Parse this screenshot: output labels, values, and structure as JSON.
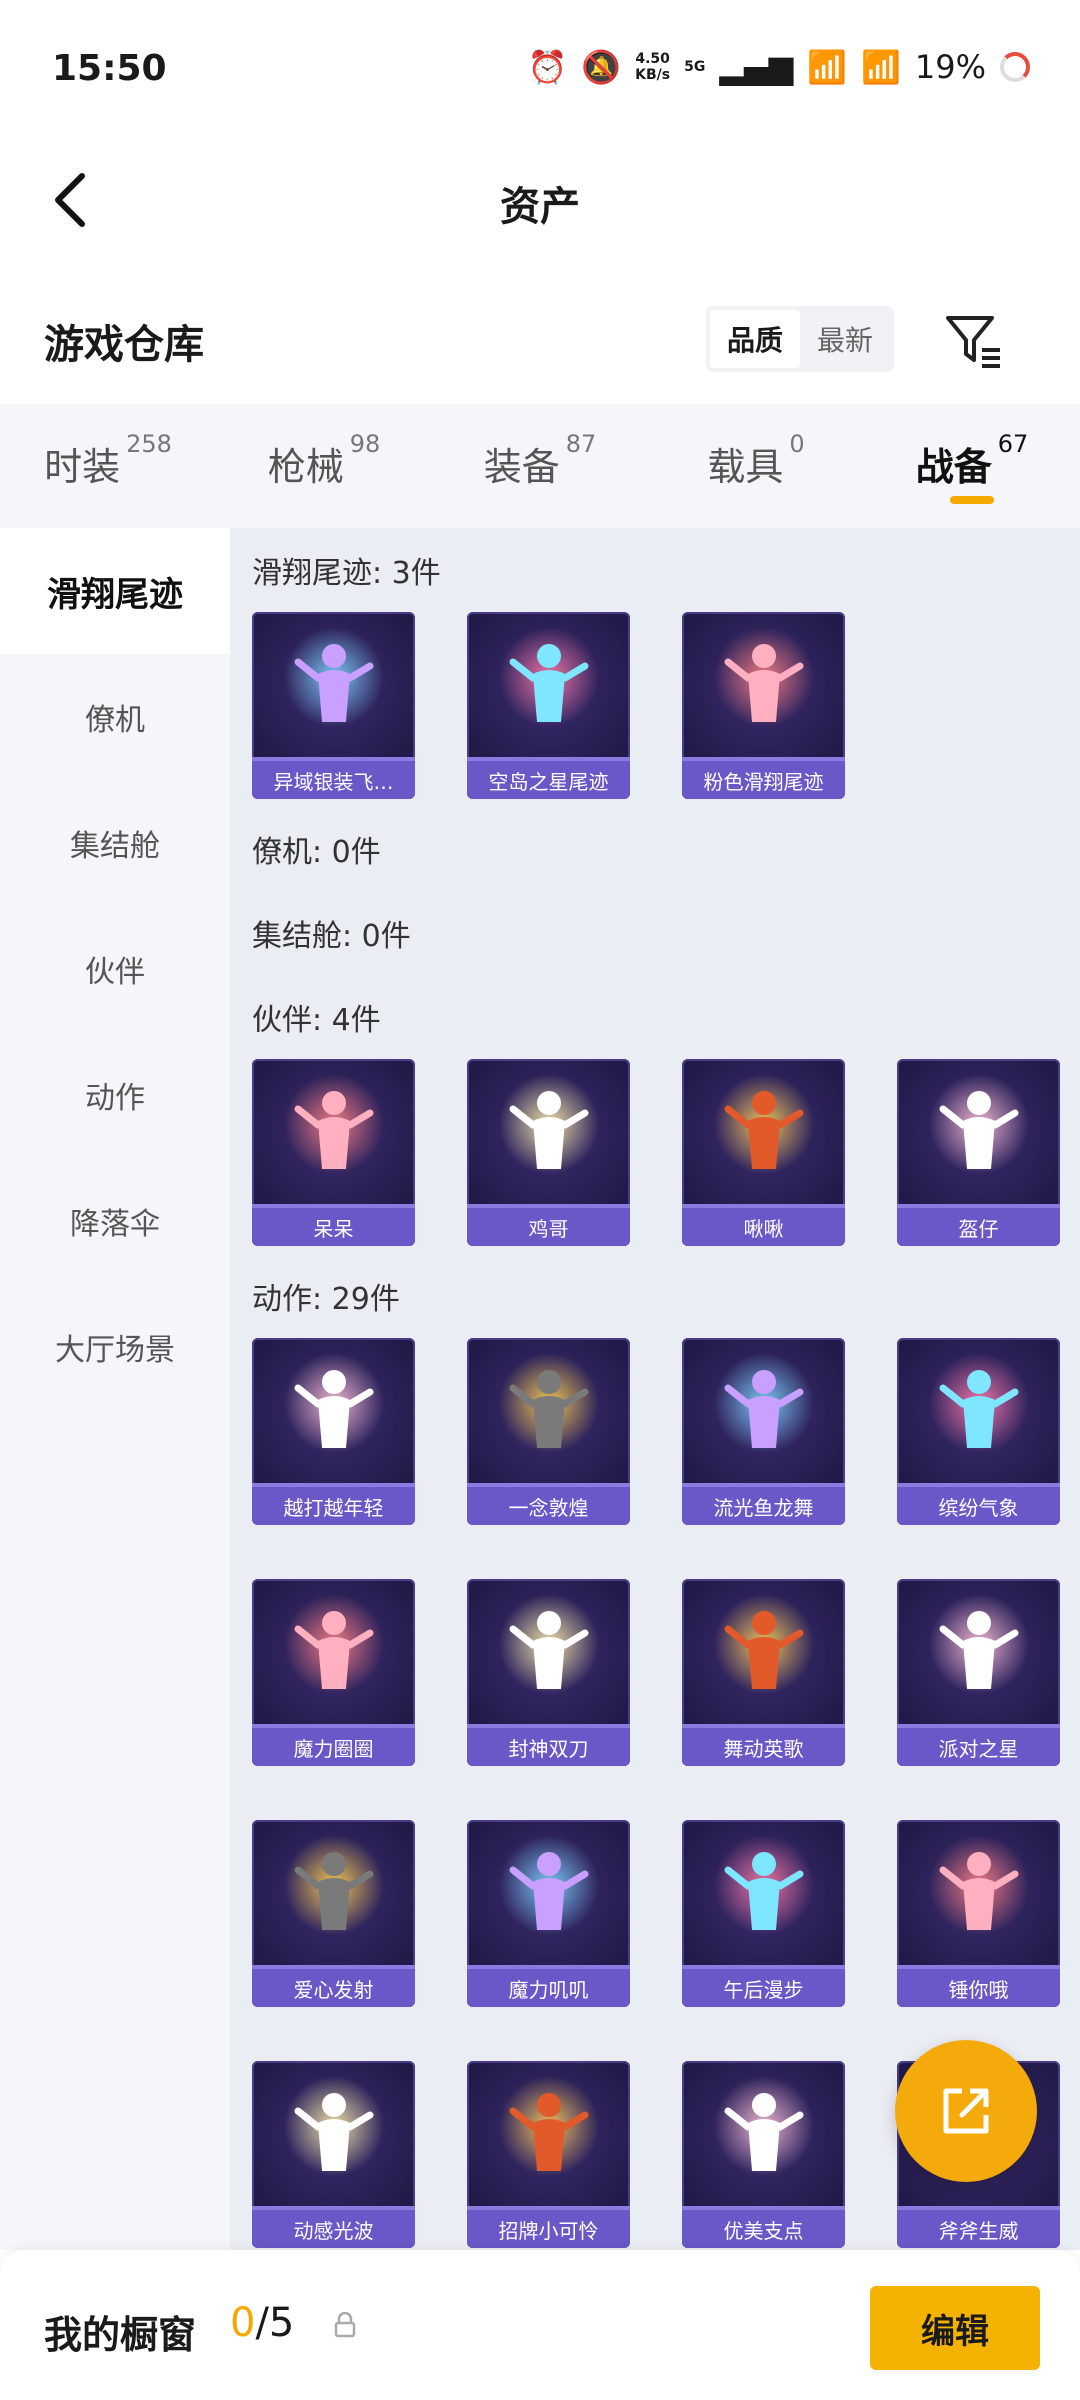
{
  "status": {
    "time": "15:50",
    "net_speed": "4.50",
    "net_unit": "KB/s",
    "net_type": "5G",
    "battery": "19%"
  },
  "header": {
    "title": "资产",
    "back_icon": "chevron-left-icon"
  },
  "section": {
    "title": "游戏仓库",
    "sort_options": [
      "品质",
      "最新"
    ],
    "sort_selected": "品质",
    "filter_icon": "filter-icon"
  },
  "tabs": [
    {
      "label": "时装",
      "count": "258"
    },
    {
      "label": "枪械",
      "count": "98"
    },
    {
      "label": "装备",
      "count": "87"
    },
    {
      "label": "载具",
      "count": "0"
    },
    {
      "label": "战备",
      "count": "67",
      "active": true
    }
  ],
  "sidebar": [
    {
      "label": "滑翔尾迹",
      "active": true
    },
    {
      "label": "僚机"
    },
    {
      "label": "集结舱"
    },
    {
      "label": "伙伴"
    },
    {
      "label": "动作"
    },
    {
      "label": "降落伞"
    },
    {
      "label": "大厅场景"
    }
  ],
  "groups": [
    {
      "header": "滑翔尾迹: 3件",
      "items": [
        "异域银装飞…",
        "空岛之星尾迹",
        "粉色滑翔尾迹"
      ]
    },
    {
      "header": "僚机: 0件",
      "items": []
    },
    {
      "header": "集结舱: 0件",
      "items": []
    },
    {
      "header": "伙伴: 4件",
      "items": [
        "呆呆",
        "鸡哥",
        "啾啾",
        "盔仔"
      ]
    },
    {
      "header": "动作: 29件",
      "items": [
        "越打越年轻",
        "一念敦煌",
        "流光鱼龙舞",
        "缤纷气象",
        "魔力圈圈",
        "封神双刀",
        "舞动英歌",
        "派对之星",
        "爱心发射",
        "魔力叽叽",
        "午后漫步",
        "锤你哦",
        "动感光波",
        "招牌小可怜",
        "优美支点",
        "斧斧生威"
      ]
    }
  ],
  "bottom": {
    "label": "我的橱窗",
    "current": "0",
    "total": "/5",
    "edit_label": "编辑"
  },
  "colors": {
    "accent": "#f5a800",
    "card_bg": "#221a4a",
    "card_label": "#6a58c8"
  }
}
